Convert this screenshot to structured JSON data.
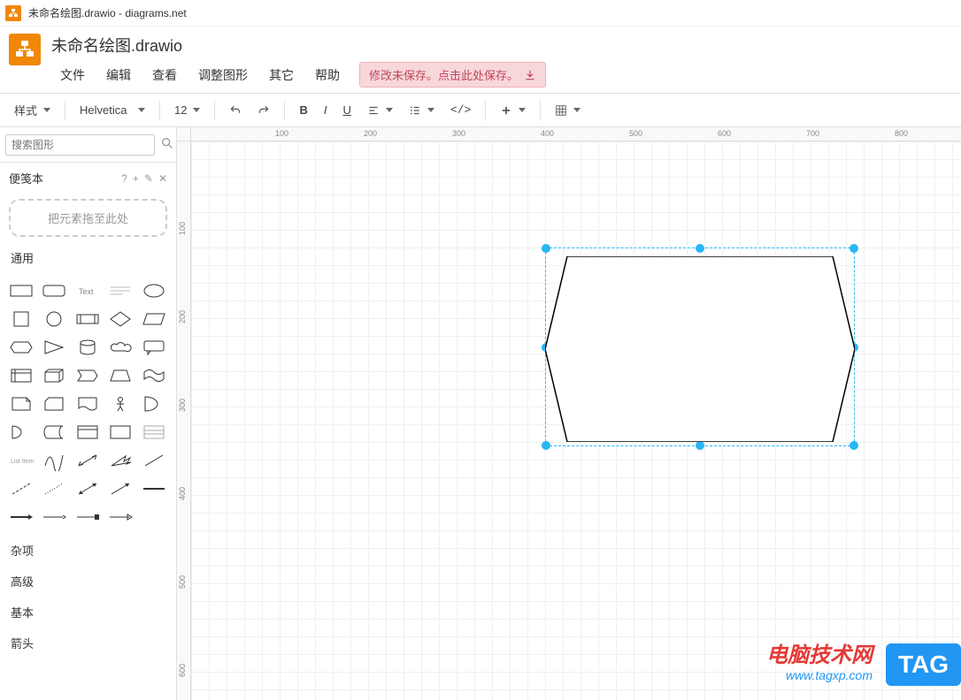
{
  "window": {
    "title": "未命名绘图.drawio - diagrams.net"
  },
  "doc": {
    "title": "未命名绘图.drawio"
  },
  "menu": {
    "file": "文件",
    "edit": "编辑",
    "view": "查看",
    "arrange": "调整图形",
    "extras": "其它",
    "help": "帮助",
    "save_notice": "修改未保存。点击此处保存。"
  },
  "toolbar": {
    "style": "样式",
    "font": "Helvetica",
    "fontsize": "12"
  },
  "sidebar": {
    "search_placeholder": "搜索图形",
    "scratchpad": "便笺本",
    "dropzone": "把元素拖至此处",
    "cat_general": "通用",
    "cat_misc": "杂项",
    "cat_advanced": "高级",
    "cat_basic": "基本",
    "cat_arrows": "箭头"
  },
  "ruler": {
    "h": [
      "100",
      "200",
      "300",
      "400",
      "500",
      "600",
      "700",
      "800"
    ],
    "v": [
      "100",
      "200",
      "300",
      "400",
      "500",
      "600"
    ]
  },
  "watermark": {
    "line1": "电脑技术网",
    "line2": "www.tagxp.com",
    "badge": "TAG"
  }
}
